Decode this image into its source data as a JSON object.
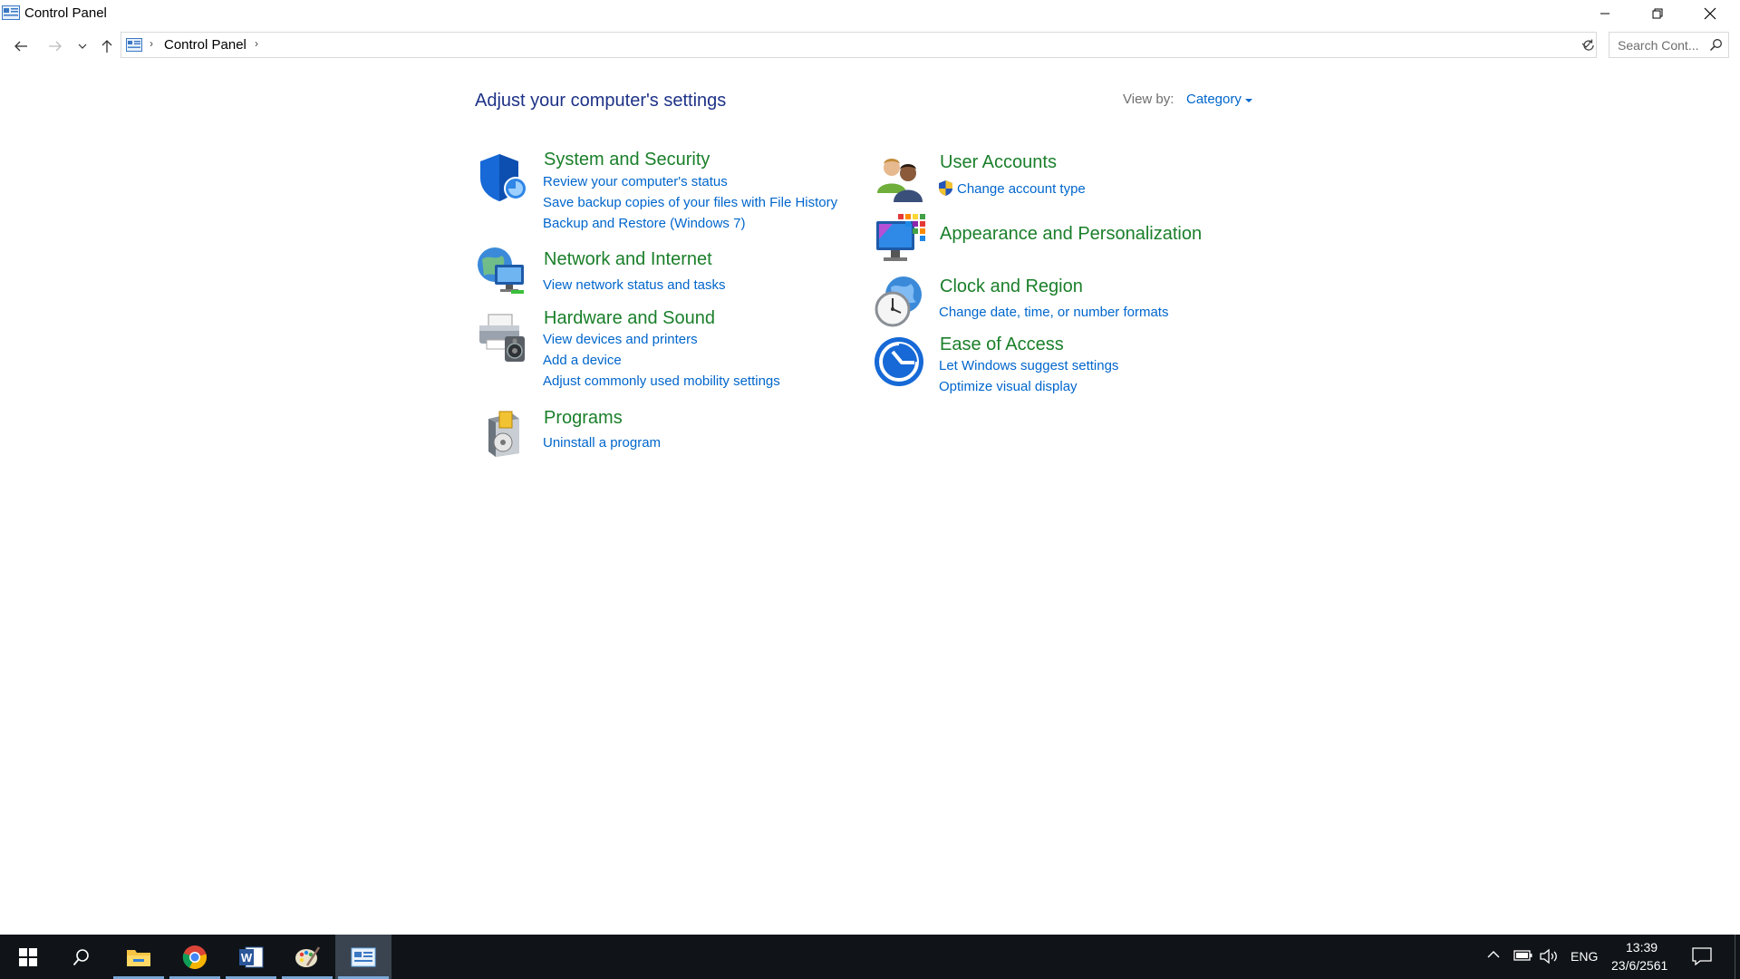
{
  "window": {
    "title": "Control Panel",
    "controls": {
      "minimize": "minimize",
      "maximize": "restore",
      "close": "close"
    }
  },
  "address_bar": {
    "breadcrumb": [
      "Control Panel"
    ],
    "search_placeholder": "Search Cont..."
  },
  "header": {
    "title": "Adjust your computer's settings",
    "view_by_label": "View by:",
    "view_by_value": "Category"
  },
  "categories": [
    {
      "title": "System and Security",
      "icon": "shield-icon",
      "links": [
        "Review your computer's status",
        "Save backup copies of your files with File History",
        "Backup and Restore (Windows 7)"
      ]
    },
    {
      "title": "Network and Internet",
      "icon": "network-globe-icon",
      "links": [
        "View network status and tasks"
      ]
    },
    {
      "title": "Hardware and Sound",
      "icon": "printer-speaker-icon",
      "links": [
        "View devices and printers",
        "Add a device",
        "Adjust commonly used mobility settings"
      ]
    },
    {
      "title": "Programs",
      "icon": "programs-box-icon",
      "links": [
        "Uninstall a program"
      ]
    },
    {
      "title": "User Accounts",
      "icon": "users-icon",
      "links": [
        "Change account type"
      ]
    },
    {
      "title": "Appearance and Personalization",
      "icon": "monitor-palette-icon",
      "links": []
    },
    {
      "title": "Clock and Region",
      "icon": "clock-globe-icon",
      "links": [
        "Change date, time, or number formats"
      ]
    },
    {
      "title": "Ease of Access",
      "icon": "ease-of-access-icon",
      "links": [
        "Let Windows suggest settings",
        "Optimize visual display"
      ]
    }
  ],
  "taskbar": {
    "apps": [
      "start-icon",
      "search-icon",
      "file-explorer-icon",
      "chrome-icon",
      "word-icon",
      "paint-icon",
      "control-panel-icon"
    ],
    "language": "ENG",
    "time": "13:39",
    "date": "23/6/2561"
  },
  "colors": {
    "heading": "#1e3287",
    "category_title": "#1a7f2a",
    "link": "#0066cc",
    "taskbar": "#101418"
  }
}
